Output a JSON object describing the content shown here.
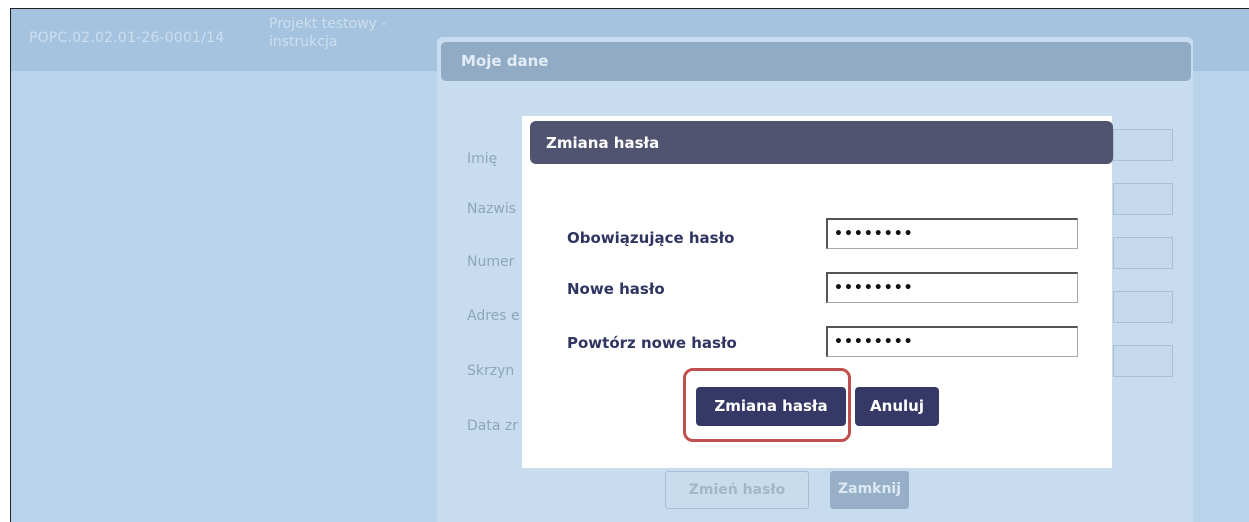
{
  "project": {
    "code": "POPC.02.02.01-26-0001/14",
    "name": "Projekt testowy - instrukcja"
  },
  "panel": {
    "title": "Moje dane",
    "fields": [
      "Imię",
      "Nazwis",
      "Numer",
      "Adres e",
      "Skrzyn",
      "Data zr"
    ],
    "change_password_label": "Zmień hasło",
    "close_label": "Zamknij"
  },
  "modal": {
    "title": "Zmiana hasła",
    "current_password_label": "Obowiązujące hasło",
    "current_password_value": "••••••••",
    "new_password_label": "Nowe hasło",
    "new_password_value": "••••••••",
    "repeat_password_label": "Powtórz nowe hasło",
    "repeat_password_value": "••••••••",
    "submit_label": "Zmiana hasła",
    "cancel_label": "Anuluj"
  },
  "colors": {
    "background": "#b9d3eb",
    "modal_header": "#505470",
    "button": "#363965",
    "label": "#2f3561",
    "highlight": "#c0504d"
  }
}
